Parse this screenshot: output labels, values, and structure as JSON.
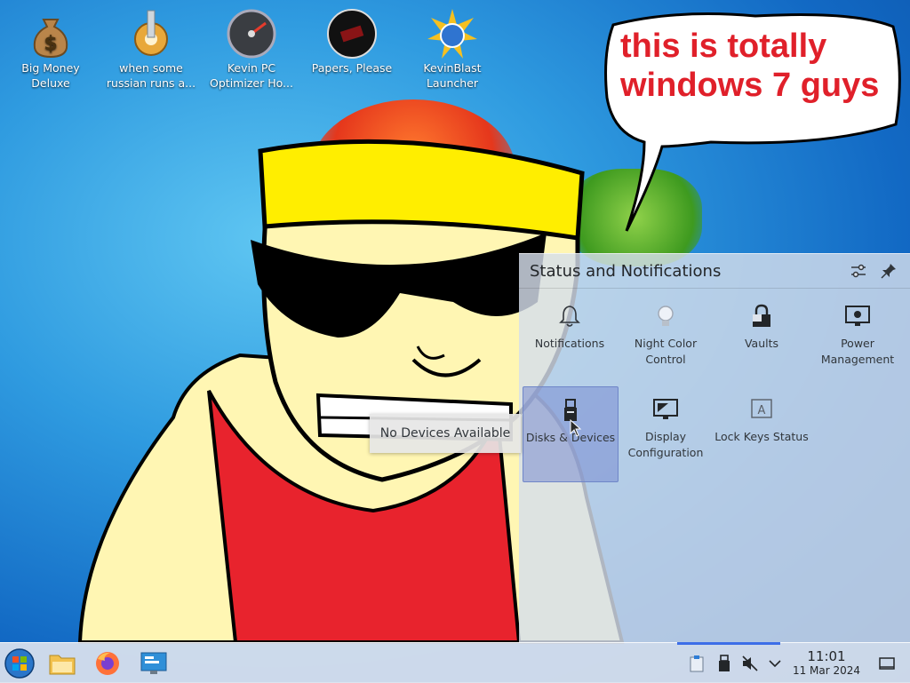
{
  "desktop": {
    "icons": [
      {
        "label": "Big Money Deluxe",
        "icon": "money-bag-icon"
      },
      {
        "label": "when some russian runs a...",
        "icon": "gear-icon"
      },
      {
        "label": "Kevin PC Optimizer Ho...",
        "icon": "gauge-icon"
      },
      {
        "label": "Papers, Please",
        "icon": "papers-please-icon"
      },
      {
        "label": "KevinBlast Launcher",
        "icon": "starburst-icon"
      }
    ],
    "speech_bubble": {
      "text": "this is totally windows 7 guys",
      "line1": "this is totally",
      "line2": "windows 7 guys"
    }
  },
  "popup": {
    "title": "Status and Notifications",
    "configure_icon": "sliders-icon",
    "pin_icon": "pin-icon",
    "items": [
      {
        "label": "Notifications",
        "icon": "bell-icon"
      },
      {
        "label": "Night Color Control",
        "icon": "lightbulb-icon"
      },
      {
        "label": "Vaults",
        "icon": "vault-lock-icon"
      },
      {
        "label": "Power Management",
        "icon": "monitor-power-icon"
      },
      {
        "label": "Disks & Devices",
        "icon": "usb-drive-icon"
      },
      {
        "label": "Display Configuration",
        "icon": "display-icon"
      },
      {
        "label": "Lock Keys Status",
        "icon": "keyboard-a-icon"
      }
    ],
    "tooltip": "No Devices Available"
  },
  "taskbar": {
    "launchers": [
      {
        "name": "start-menu",
        "icon": "windows-orb-icon"
      },
      {
        "name": "file-manager",
        "icon": "folder-icon"
      },
      {
        "name": "firefox",
        "icon": "firefox-icon"
      },
      {
        "name": "system-settings",
        "icon": "settings-monitor-icon"
      }
    ],
    "tray": [
      {
        "name": "clipboard",
        "icon": "clipboard-icon"
      },
      {
        "name": "disks",
        "icon": "usb-drive-icon"
      },
      {
        "name": "volume-muted",
        "icon": "speaker-muted-icon"
      },
      {
        "name": "expand",
        "icon": "chevron-down-icon"
      }
    ],
    "clock": {
      "time": "11:01",
      "date": "11 Mar 2024"
    },
    "show_desktop_icon": "show-desktop-icon",
    "progress": 0.58,
    "colors": {
      "panel": "#dae2ee",
      "accent": "#3d6ee8",
      "bubble_text": "#e0202a"
    }
  }
}
